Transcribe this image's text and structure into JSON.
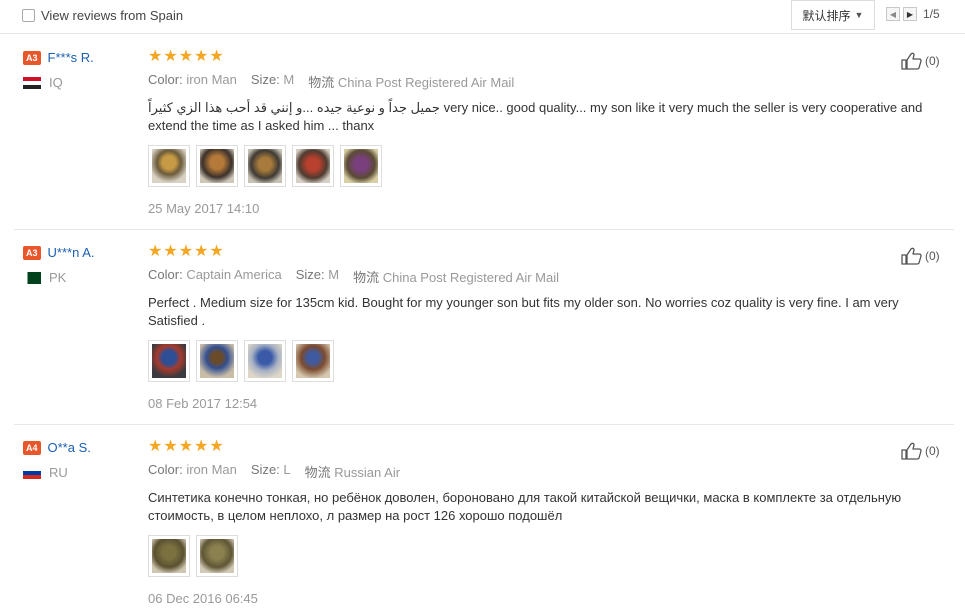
{
  "toolbar": {
    "filter_label": "View reviews from Spain",
    "sort_label": "默认排序",
    "page_indicator": "1/5"
  },
  "reviews": [
    {
      "level": "A3",
      "name": "F***s R.",
      "country": "IQ",
      "color_label": "Color:",
      "color": "iron Man",
      "size_label": "Size:",
      "size": "M",
      "logistics_label": "物流",
      "logistics": "China Post Registered Air Mail",
      "text": "جميل جداً و نوعية جيده ...و إنني قد أحب هذا الزي كثيراً very nice.. good quality... my son like it very much the seller is very cooperative and extend the time as I asked him ... thanx",
      "date": "25 May 2017 14:10",
      "helpful": "(0)",
      "rating": 5,
      "photos": [
        "p-gold1",
        "p-gold2",
        "p-gold3",
        "p-red",
        "p-purple"
      ]
    },
    {
      "level": "A3",
      "name": "U***n A.",
      "country": "PK",
      "color_label": "Color:",
      "color": "Captain America",
      "size_label": "Size:",
      "size": "M",
      "logistics_label": "物流",
      "logistics": "China Post Registered Air Mail",
      "text": "Perfect . Medium size for 135cm kid. Bought for my younger son but fits my older son. No worries coz quality is very fine. I am very Satisfied .",
      "date": "08 Feb 2017 12:54",
      "helpful": "(0)",
      "rating": 5,
      "photos": [
        "p-blue1",
        "p-blue2",
        "p-blue3",
        "p-blue4"
      ]
    },
    {
      "level": "A4",
      "name": "O**a S.",
      "country": "RU",
      "color_label": "Color:",
      "color": "iron Man",
      "size_label": "Size:",
      "size": "L",
      "logistics_label": "物流",
      "logistics": "Russian Air",
      "text": "Синтетика конечно тонкая, но ребёнок доволен, бороновано для такой китайской вещички, маска в комплекте за отдельную стоимость, в целом неплохо, л размер на рост 126 хорошо подошёл",
      "date": "06 Dec 2016 06:45",
      "helpful": "(0)",
      "rating": 5,
      "photos": [
        "p-olive1",
        "p-olive2"
      ]
    }
  ],
  "colors": {
    "level_badge": "#e8562a",
    "username": "#1a5fb4",
    "star": "#f5a623"
  },
  "icons": {
    "helpful": "thumbs-up-icon",
    "star": "star-icon"
  }
}
